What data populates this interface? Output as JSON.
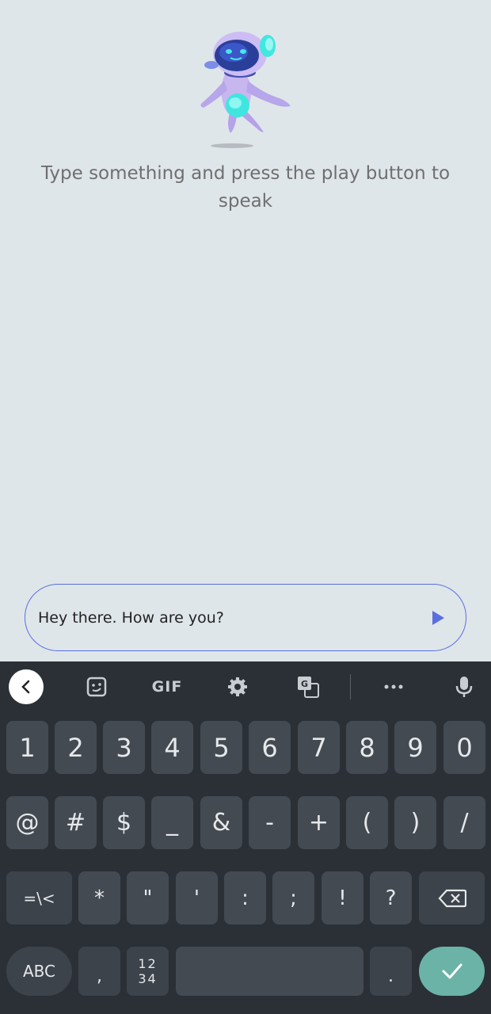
{
  "prompt_text": "Type something and press the play button to speak",
  "input": {
    "value": "Hey there. How are you?"
  },
  "accent_color": "#5b6ee0",
  "toolbar": {
    "gif_label": "GIF",
    "icons": [
      "back-icon",
      "sticker-icon",
      "gif-icon",
      "settings-icon",
      "translate-icon",
      "more-icon",
      "mic-icon"
    ]
  },
  "keys": {
    "row1": [
      "1",
      "2",
      "3",
      "4",
      "5",
      "6",
      "7",
      "8",
      "9",
      "0"
    ],
    "row2": [
      "@",
      "#",
      "$",
      "_",
      "&",
      "-",
      "+",
      "(",
      ")",
      "/"
    ],
    "row3": [
      "=\\<",
      "*",
      "\"",
      "'",
      ":",
      ";",
      "!",
      "?"
    ],
    "row4": {
      "abc": "ABC",
      "comma": ",",
      "numpad_top": "12",
      "numpad_bottom": "34",
      "period": "."
    }
  }
}
